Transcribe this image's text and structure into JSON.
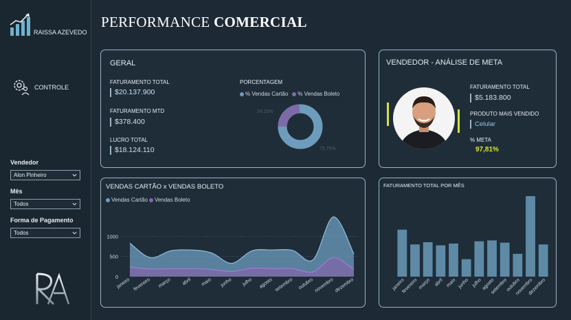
{
  "sidebar": {
    "brand": "RAISSA AZEVEDO",
    "nav_controle": "CONTROLE",
    "filters": [
      {
        "label": "Vendedor",
        "value": "Alon Pinheiro"
      },
      {
        "label": "Mês",
        "value": "Todos"
      },
      {
        "label": "Forma de Pagamento",
        "value": "Todos"
      }
    ]
  },
  "header": {
    "title_light": "PERFORMANCE ",
    "title_bold": "COMERCIAL"
  },
  "geral": {
    "title": "GERAL",
    "kpis": [
      {
        "label": "FATURAMENTO TOTAL",
        "value": "$20.137.900"
      },
      {
        "label": "FATURAMENTO MTD",
        "value": "$378.400"
      },
      {
        "label": "LUCRO TOTAL",
        "value": "$18.124.110"
      }
    ],
    "porcentagem_title": "PORCENTAGEM",
    "legend_cartao": "% Vendas Cartão",
    "legend_boleto": "% Vendas Boleto",
    "label_boleto": "24,25%",
    "label_cartao": "75,75%"
  },
  "vendedor": {
    "title": "VENDEDOR -  ANÁLISE DE META",
    "fat_label": "FATURAMENTO TOTAL",
    "fat_value": "$5.183.800",
    "produto_label": "PRODUTO MAIS VENDIDO",
    "produto_value": "Celular",
    "meta_label": "% META",
    "meta_value": "97,81%"
  },
  "colors": {
    "cartao": "#6e9cbd",
    "boleto": "#7d6aa8",
    "meta": "#d8e43a",
    "bar": "#5e8aa6"
  },
  "chart_data": [
    {
      "type": "area",
      "title": "VENDAS CARTÃO x VENDAS BOLETO",
      "x": [
        "janeiro",
        "fevereiro",
        "março",
        "abril",
        "maio",
        "junho",
        "julho",
        "agosto",
        "setembro",
        "outubro",
        "novembro",
        "dezembro"
      ],
      "series": [
        {
          "name": "Vendas Cartão",
          "values": [
            830,
            470,
            640,
            660,
            590,
            330,
            640,
            660,
            650,
            420,
            1480,
            560
          ]
        },
        {
          "name": "Vendas Boleto",
          "values": [
            240,
            190,
            200,
            200,
            180,
            130,
            210,
            200,
            200,
            120,
            470,
            180
          ]
        }
      ],
      "y_ticks": [
        0,
        500,
        1000
      ],
      "ylim": [
        0,
        1500
      ],
      "legend": "top-left"
    },
    {
      "type": "bar",
      "title": "FATURAMENTO TOTAL POR MÊS",
      "categories": [
        "janeiro",
        "fevereiro",
        "março",
        "abril",
        "maio",
        "junho",
        "julho",
        "agosto",
        "setembro",
        "outubro",
        "novembro",
        "dezembro"
      ],
      "values": [
        1050,
        720,
        770,
        700,
        740,
        390,
        790,
        810,
        760,
        510,
        1800,
        720
      ],
      "ylim": [
        0,
        2000
      ]
    }
  ]
}
